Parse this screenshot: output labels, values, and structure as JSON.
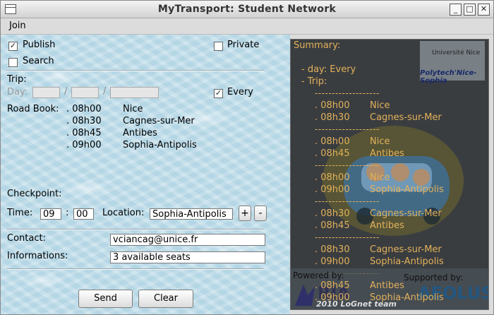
{
  "window": {
    "title": "MyTransport: Student Network",
    "controls": [
      "_",
      "□",
      "✕"
    ]
  },
  "menu": {
    "join": "Join"
  },
  "form": {
    "publish": {
      "label": "Publish",
      "checked": true
    },
    "search": {
      "label": "Search",
      "checked": false
    },
    "private": {
      "label": "Private",
      "checked": false
    },
    "trip_label": "Trip:",
    "day_label": "Day:",
    "slash": "/",
    "every": {
      "label": "Every",
      "checked": true
    },
    "roadbook_label": "Road Book:",
    "roadbook": [
      {
        "time": ". 08h00",
        "place": "Nice"
      },
      {
        "time": ". 08h30",
        "place": "Cagnes-sur-Mer"
      },
      {
        "time": ". 08h45",
        "place": "Antibes"
      },
      {
        "time": ". 09h00",
        "place": "Sophia-Antipolis"
      }
    ],
    "checkpoint_label": "Checkpoint:",
    "time_label": "Time:",
    "hour": "09",
    "colon": ":",
    "minute": "00",
    "location_label": "Location:",
    "location": "Sophia-Antipolis",
    "plus": "+",
    "minus": "-",
    "contact_label": "Contact:",
    "contact": "vciancag@unice.fr",
    "info_label": "Informations:",
    "info": "3 available seats",
    "send": "Send",
    "clear": "Clear"
  },
  "summary": {
    "title": "Summary:",
    "day": "- day: Every",
    "trip": "- Trip:",
    "separator": "-------------------",
    "segments": [
      {
        "a_time": ". 08h00",
        "a_place": "Nice",
        "b_time": ". 08h30",
        "b_place": "Cagnes-sur-Mer"
      },
      {
        "a_time": ". 08h00",
        "a_place": "Nice",
        "b_time": ". 08h45",
        "b_place": "Antibes"
      },
      {
        "a_time": ". 08h00",
        "a_place": "Nice",
        "b_time": ". 09h00",
        "b_place": "Sophia-Antipolis"
      },
      {
        "a_time": ". 08h30",
        "a_place": "Cagnes-sur-Mer",
        "b_time": ". 08h45",
        "b_place": "Antibes"
      },
      {
        "a_time": ". 08h30",
        "a_place": "Cagnes-sur-Mer",
        "b_time": ". 09h00",
        "b_place": "Sophia-Antipolis"
      },
      {
        "a_time": ". 08h45",
        "a_place": "Antibes",
        "b_time": ". 09h00",
        "b_place": "Sophia-Antipolis"
      }
    ],
    "logo_univ": "Université Nice",
    "logo_polytech": "Polytech'Nice-Sophia",
    "powered_by": "Powered by:",
    "supported_by": "Supported by:",
    "footer_brand_left": "RIA",
    "footer_brand_right": "AEOLUS",
    "credit": "2010 LoGnet team",
    "accent": "#e2b15a"
  }
}
